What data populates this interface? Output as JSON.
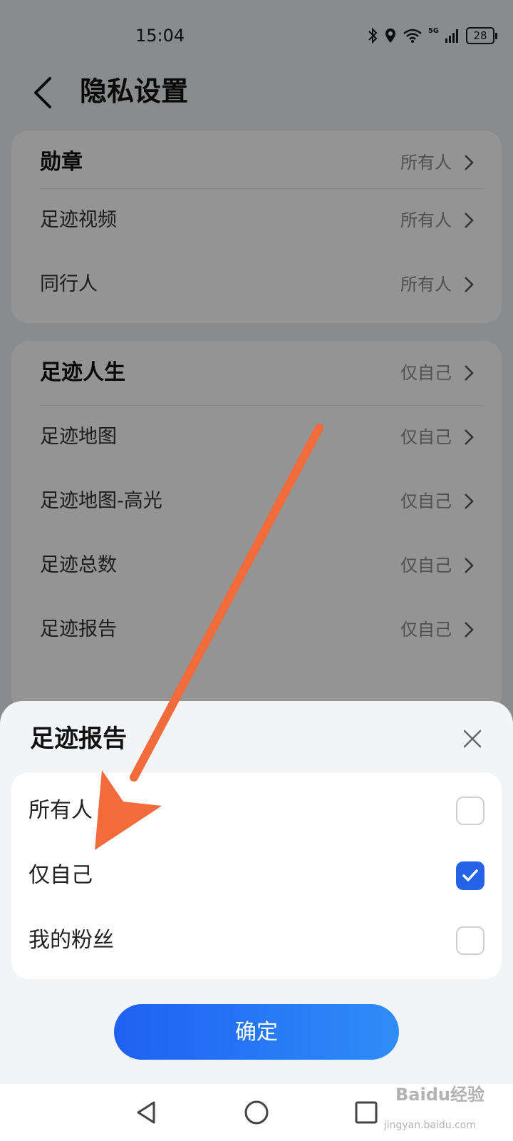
{
  "status_bar": {
    "time": "15:04",
    "battery": "28",
    "network": "5G"
  },
  "header": {
    "title": "隐私设置"
  },
  "group1": [
    {
      "label": "勋章",
      "value": "所有人"
    },
    {
      "label": "足迹视频",
      "value": "所有人"
    },
    {
      "label": "同行人",
      "value": "所有人"
    }
  ],
  "group2": [
    {
      "label": "足迹人生",
      "value": "仅自己"
    },
    {
      "label": "足迹地图",
      "value": "仅自己"
    },
    {
      "label": "足迹地图-高光",
      "value": "仅自己"
    },
    {
      "label": "足迹总数",
      "value": "仅自己"
    },
    {
      "label": "足迹报告",
      "value": "仅自己"
    }
  ],
  "sheet": {
    "title": "足迹报告",
    "options": [
      {
        "label": "所有人",
        "checked": false
      },
      {
        "label": "仅自己",
        "checked": true
      },
      {
        "label": "我的粉丝",
        "checked": false
      }
    ],
    "confirm": "确定"
  },
  "watermark": {
    "main": "Baidu经验",
    "sub": "jingyan.baidu.com"
  },
  "colors": {
    "accent": "#2462e8",
    "arrow": "#f26b3a"
  }
}
